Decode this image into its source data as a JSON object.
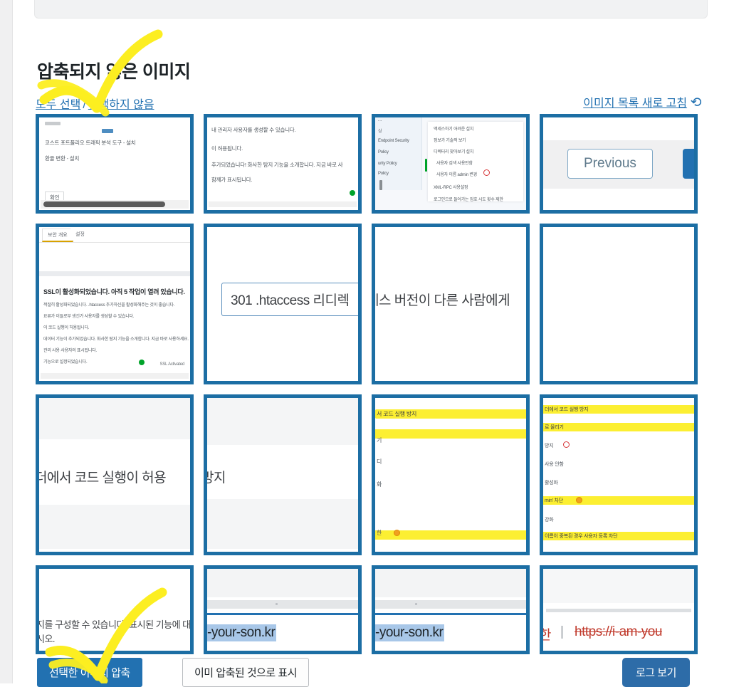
{
  "page": {
    "title": "압축되지 않은 이미지",
    "select_all_label": "모두 선택",
    "select_separator": "/",
    "select_none_label": "선택하지 않음",
    "refresh_label": "이미지 목록 새로 고침",
    "refresh_icon": "refresh-icon"
  },
  "footer": {
    "compress_label": "선택한 이미지 압축",
    "mark_compressed_label": "이미 압축된 것으로 표시",
    "view_log_label": "로그 보기"
  },
  "annotations": {
    "color": "#fcee21",
    "top_mark": "check-mark",
    "bottom_mark": "check-mark"
  },
  "colors": {
    "thumb_border": "#1c6ea4",
    "link": "#2271b1",
    "primary_button": "#2271b1",
    "log_button": "#2d6ca8",
    "highlighter": "#fcee21",
    "error_red": "#c0392b",
    "success_green": "#00a32a"
  },
  "thumbnails": [
    {
      "id": "thumb-1",
      "kind": "document-scroll",
      "lines": [
        "코스트 포트폴리오 트래픽 분석 도구 - 설치",
        "환율 변환 - 설치"
      ],
      "button_label": "확인",
      "has_hscrollbar": true
    },
    {
      "id": "thumb-2",
      "kind": "text-block",
      "lines": [
        "내 관리자 사용자를 생성할 수 있습니다.",
        "이 허용됩니다.",
        "추가되었습니다! 화사한 탐지 기능을 소개합니다. 지금 바로 사",
        "함께가 표시됩니다."
      ]
    },
    {
      "id": "thumb-3",
      "kind": "settings-panel",
      "sidebar_items": [
        "싱",
        "Endpoint Security",
        "Policy",
        "urity Policy",
        "Policy"
      ],
      "list_items": [
        "액세스하기 어려운 설치",
        "정보가 기술적 보기",
        "디렉터리 찾아보기 설치",
        "사용자 검색 사용안함",
        "사용자 이름 admin 변경",
        "XML-RPC 사용설정",
        "로그인으로 들어가는 암호 시도 횟수 제한"
      ]
    },
    {
      "id": "thumb-4",
      "kind": "pagination",
      "prev_label": "Previous",
      "next_visible": true
    },
    {
      "id": "thumb-5",
      "kind": "tabbed-report",
      "tabs": [
        "보안 개요",
        "설정"
      ],
      "heading": "SSL이 활성화되었습니다. 아직 5 작업이 열려 있습니다.",
      "lines": [
        "적절히 활성화되었습니다. .htaccess 추가하신을 활성화해주는 것이 좋습니다.",
        "요류가 이들로부 생긴가 사용자를 생성할 수 있습니다.",
        "이 코드 실행이 허용됩니다.",
        "데이터 기능이 추가되었습니다. 화사한 탐지 기능을 소개합니다. 지금 바로 사용하세요.",
        "관리 사용 사용자의 표시됩니다.",
        "기능으로 설정되었습니다."
      ],
      "status_label": "SSL Activated"
    },
    {
      "id": "thumb-6",
      "kind": "input-box",
      "value": "301 .htaccess 리디렉"
    },
    {
      "id": "thumb-7",
      "kind": "plain-text",
      "text": "레스 버전이 다른 사람에게"
    },
    {
      "id": "thumb-8",
      "kind": "blank"
    },
    {
      "id": "thumb-9",
      "kind": "plain-text",
      "text": "더에서 코드 실행이 허용"
    },
    {
      "id": "thumb-10",
      "kind": "plain-text",
      "text": "방지"
    },
    {
      "id": "thumb-11",
      "kind": "highlighted-list",
      "items": [
        {
          "text": "서 코드 실행 방지",
          "highlight": true
        },
        {
          "text": "",
          "highlight": true
        },
        {
          "text": "기",
          "highlight": false
        },
        {
          "text": "디",
          "highlight": false
        },
        {
          "text": "화",
          "highlight": false
        },
        {
          "text": "한",
          "highlight": true,
          "icon": "warning-icon"
        }
      ]
    },
    {
      "id": "thumb-12",
      "kind": "highlighted-list",
      "items": [
        {
          "text": "더에서 코드 실행 방지",
          "highlight": true
        },
        {
          "text": "로 올리기",
          "highlight": true
        },
        {
          "text": "방지",
          "highlight": false,
          "icon": "info-icon"
        },
        {
          "text": "사용 안함",
          "highlight": false
        },
        {
          "text": "활성화",
          "highlight": false
        },
        {
          "text": "min' 차단",
          "highlight": true,
          "icon": "warning-icon"
        },
        {
          "text": "강화",
          "highlight": false
        },
        {
          "text": "이름이 중복된 경우 사용자 등록 차단",
          "highlight": true
        }
      ]
    },
    {
      "id": "thumb-13",
      "kind": "plain-text-2",
      "lines": [
        "지를 구성할 수 있습니다. 표시된 기능에 대해 지",
        "시오."
      ]
    },
    {
      "id": "thumb-14",
      "kind": "url-selected",
      "value": "-your-son.kr"
    },
    {
      "id": "thumb-15",
      "kind": "url-selected",
      "value": "-your-son.kr"
    },
    {
      "id": "thumb-16",
      "kind": "url-struck",
      "prefix": "한",
      "separator": "|",
      "url": "https://i-am-you"
    }
  ]
}
